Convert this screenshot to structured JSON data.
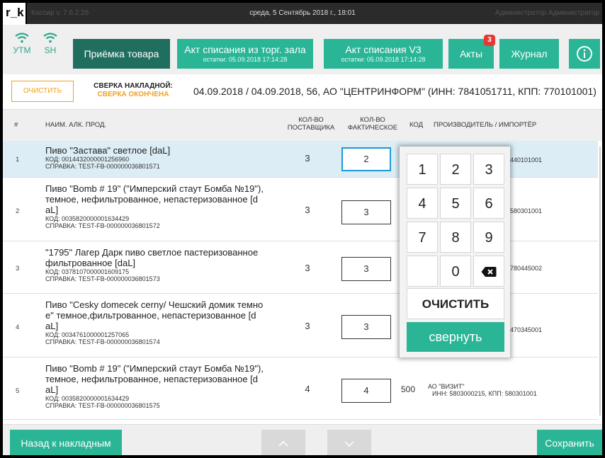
{
  "titlebar": {
    "logo": "r_k",
    "version": "Кассир v. 7.6.2.26",
    "datetime": "среда, 5 Сентябрь 2018 г., 18:01",
    "user": "Администратор Администратор"
  },
  "toolbar": {
    "utm_label": "УТМ",
    "sh_label": "SH",
    "receive_goods": "Приёмка товара",
    "writeoff_hall": {
      "title": "Акт списания из торг. зала",
      "sub": "остатки: 05.09.2018 17:14:28"
    },
    "writeoff_v3": {
      "title": "Акт списания V3",
      "sub": "остатки: 05.09.2018 17:14:28"
    },
    "acts": {
      "label": "Акты",
      "badge": "3"
    },
    "journal": "Журнал",
    "info_icon": "info-icon"
  },
  "reconciliation": {
    "clear_button": "ОЧИСТИТЬ",
    "title": "СВЕРКА НАКЛАДНОЙ:",
    "status": "СВЕРКА ОКОНЧЕНА",
    "invoice_info": "04.09.2018 / 04.09.2018, 56, АО \"ЦЕНТРИНФОРМ\" (ИНН: 7841051711, КПП: 770101001)"
  },
  "table": {
    "headers": {
      "num": "#",
      "name": "НАИМ. АЛК. ПРОД.",
      "qty_supplier_1": "КОЛ-ВО",
      "qty_supplier_2": "ПОСТАВЩИКА",
      "qty_actual_1": "КОЛ-ВО",
      "qty_actual_2": "ФАКТИЧЕСКОЕ",
      "code": "КОД",
      "manufacturer": "ПРОИЗВОДИТЕЛЬ / ИМПОРТЁР"
    },
    "rows": [
      {
        "num": "1",
        "name_lines": [
          "Пиво \"Застава\" светлое  [daL]"
        ],
        "code_line": "КОД: 0014432000001256960",
        "ref_line": "СПРАВКА: TEST-FB-000000036801571",
        "qty_supplier": "3",
        "qty_actual": "2",
        "mfr_tail": "440101001"
      },
      {
        "num": "2",
        "name_lines": [
          "Пиво \"Bomb # 19\" (\"Имперский стаут Бомба №19\"),",
          "темное, нефильтрованное, непастеризованное  [d",
          "aL]"
        ],
        "code_line": "КОД: 0035820000001634429",
        "ref_line": "СПРАВКА: TEST-FB-000000036801572",
        "qty_supplier": "3",
        "qty_actual": "3",
        "mfr_tail": "580301001"
      },
      {
        "num": "3",
        "name_lines": [
          "\"1795\" Лагер Дарк пиво светлое пастеризованное",
          "фильтрованное  [daL]"
        ],
        "code_line": "КОД: 0378107000001609175",
        "ref_line": "СПРАВКА: TEST-FB-000000036801573",
        "qty_supplier": "3",
        "qty_actual": "3",
        "mfr_tail": "780445002"
      },
      {
        "num": "4",
        "name_lines": [
          "Пиво \"Cesky domecek cerny/ Чешский домик темно",
          "е\" темное,фильтрованное, непастеризованное  [d",
          "aL]"
        ],
        "code_line": "КОД: 0034761000001257065",
        "ref_line": "СПРАВКА: TEST-FB-000000036801574",
        "qty_supplier": "3",
        "qty_actual": "3",
        "mfr_tail": "470345001"
      },
      {
        "num": "5",
        "name_lines": [
          "Пиво \"Bomb # 19\" (\"Имперский стаут Бомба №19\"),",
          "темное, нефильтрованное, непастеризованное  [d",
          "aL]"
        ],
        "code_line": "КОД: 0035820000001634429",
        "ref_line": "СПРАВКА: TEST-FB-000000036801575",
        "qty_supplier": "4",
        "qty_actual": "4",
        "code": "500",
        "mfr_name": "АО \"ВИЗИТ\"",
        "mfr_ids": "ИНН: 5803000215, КПП: 580301001"
      }
    ]
  },
  "numpad": {
    "keys": [
      "1",
      "2",
      "3",
      "4",
      "5",
      "6",
      "7",
      "8",
      "9",
      "0"
    ],
    "backspace_icon": "backspace-icon",
    "clear": "ОЧИСТИТЬ",
    "collapse": "свернуть"
  },
  "footer": {
    "back": "Назад к накладным",
    "up_icon": "chevron-up-icon",
    "down_icon": "chevron-down-icon",
    "save": "Сохранить"
  },
  "colors": {
    "accent": "#2ab597",
    "accent_dark": "#1f6e5e",
    "warning": "#f0a020",
    "selection": "#dcedf5",
    "badge": "#e53935"
  }
}
